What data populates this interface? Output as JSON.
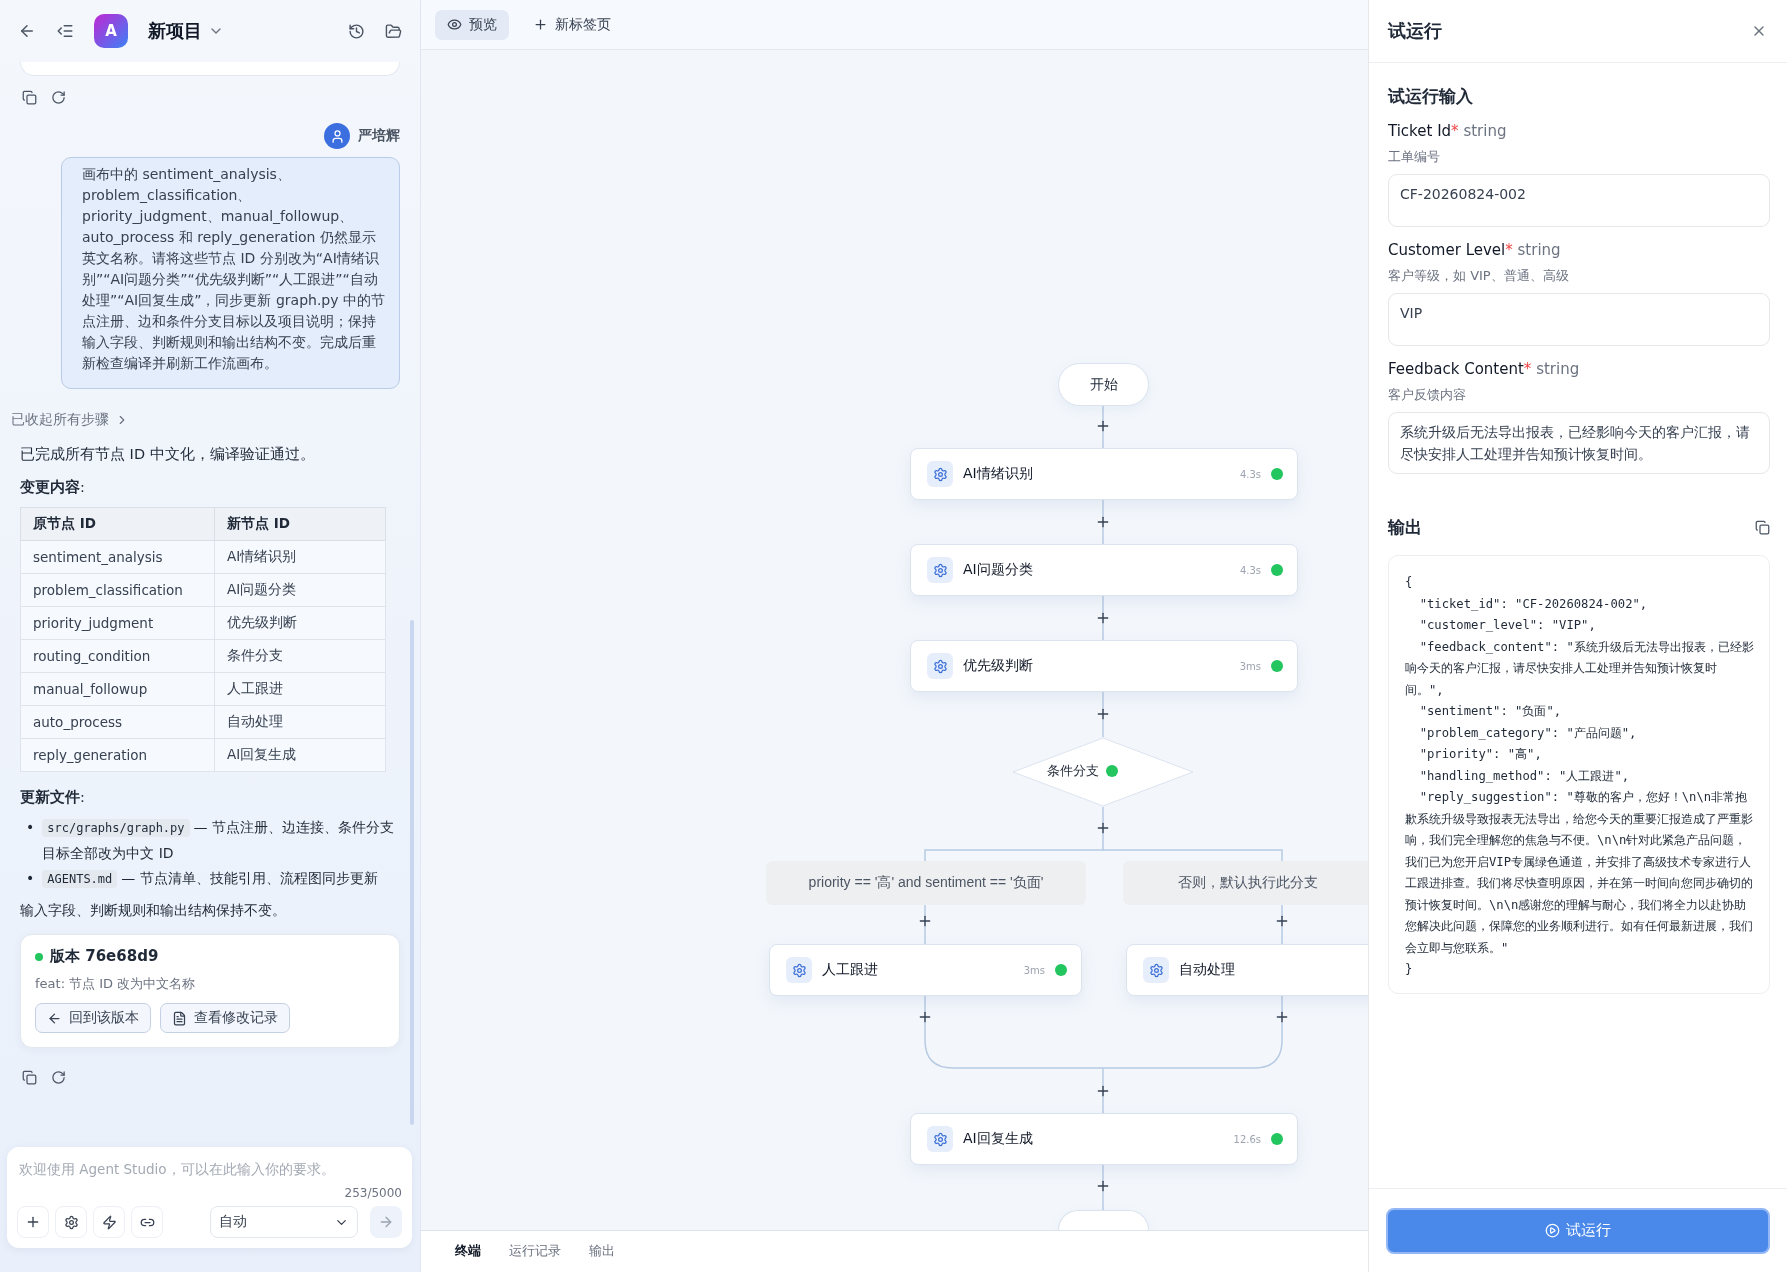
{
  "header": {
    "avatar": "A",
    "project": "新项目"
  },
  "user": {
    "name": "严培辉",
    "message": "画布中的 sentiment_analysis、problem_classification、priority_judgment、manual_followup、auto_process 和 reply_generation 仍然显示英文名称。请将这些节点 ID 分别改为“AI情绪识别”“AI问题分类”“优先级判断”“人工跟进”“自动处理”“AI回复生成”，同步更新 graph.py 中的节点注册、边和条件分支目标以及项目说明；保持输入字段、判断规则和输出结构不变。完成后重新检查编译并刷新工作流画布。"
  },
  "steps_link": "已收起所有步骤",
  "reply": {
    "summary": "已完成所有节点 ID 中文化，编译验证通过。",
    "changes_heading": "**变更内容**:",
    "table": {
      "columns": [
        "原节点 ID",
        "新节点 ID"
      ],
      "rows": [
        [
          "sentiment_analysis",
          "AI情绪识别"
        ],
        [
          "problem_classification",
          "AI问题分类"
        ],
        [
          "priority_judgment",
          "优先级判断"
        ],
        [
          "routing_condition",
          "条件分支"
        ],
        [
          "manual_followup",
          "人工跟进"
        ],
        [
          "auto_process",
          "自动处理"
        ],
        [
          "reply_generation",
          "AI回复生成"
        ]
      ]
    },
    "files_heading": "**更新文件**:",
    "files": [
      {
        "bullet": "•",
        "code": "src/graphs/graph.py",
        "text": "— 节点注册、边连接、条件分支目标全部改为中文 ID"
      },
      {
        "bullet": "•",
        "code": "AGENTS.md",
        "text": "— 节点清单、技能引用、流程图同步更新"
      }
    ],
    "note": "输入字段、判断规则和输出结构保持不变。"
  },
  "version": {
    "title": "版本 76e68d9",
    "color": "#22c55e",
    "message": "feat: 节点 ID 改为中文名称",
    "buttons": [
      "回到该版本",
      "查看修改记录"
    ]
  },
  "composer": {
    "placeholder": "欢迎使用 Agent Studio，可以在此输入你的要求。",
    "counter": "253/5000",
    "mode": "自动"
  },
  "canvas_tabs": [
    {
      "label": "预览",
      "selected": true
    },
    {
      "label": "新标签页",
      "selected": false
    }
  ],
  "flow": {
    "start": "开始",
    "nodes": [
      {
        "label": "AI情绪识别",
        "time": "4.3s",
        "color": "#22c55e"
      },
      {
        "label": "AI问题分类",
        "time": "4.3s",
        "color": "#22c55e"
      },
      {
        "label": "优先级判断",
        "time": "3ms",
        "color": "#22c55e"
      }
    ],
    "condition": {
      "label": "条件分支",
      "color": "#22c55e"
    },
    "branches": [
      {
        "condition": "priority == '高' and sentiment == '负面'",
        "node": {
          "label": "人工跟进",
          "time": "3ms",
          "color": "#22c55e"
        }
      },
      {
        "condition": "否则，默认执行此分支",
        "node": {
          "label": "自动处理"
        }
      }
    ],
    "final": {
      "label": "AI回复生成",
      "time": "12.6s",
      "color": "#22c55e"
    }
  },
  "bottom_tabs": [
    {
      "label": "终端",
      "selected": true
    },
    {
      "label": "运行记录",
      "selected": false
    },
    {
      "label": "输出",
      "selected": false
    }
  ],
  "panel": {
    "title": "试运行",
    "section": "试运行输入",
    "fields": [
      {
        "label": "Ticket Id",
        "required": "*",
        "type": "string",
        "hint": "工单编号",
        "value": "CF-20260824-002"
      },
      {
        "label": "Customer Level",
        "required": "*",
        "type": "string",
        "hint": "客户等级，如 VIP、普通、高级",
        "value": "VIP"
      },
      {
        "label": "Feedback Content",
        "required": "*",
        "type": "string",
        "hint": "客户反馈内容",
        "value": "系统升级后无法导出报表，已经影响今天的客户汇报，请尽快安排人工处理并告知预计恢复时间。"
      }
    ],
    "output_title": "输出",
    "output": [
      "{",
      "  \"ticket_id\": \"CF-20260824-002\",",
      "  \"customer_level\": \"VIP\",",
      "  \"feedback_content\": \"系统升级后无法导出报表，已经影响今天的客户汇报，请尽快安排人工处理并告知预计恢复时间。\",",
      "  \"sentiment\": \"负面\",",
      "  \"problem_category\": \"产品问题\",",
      "  \"priority\": \"高\",",
      "  \"handling_method\": \"人工跟进\",",
      "  \"reply_suggestion\": \"尊敬的客户，您好！\\n\\n非常抱歉系统升级导致报表无法导出，给您今天的重要汇报造成了严重影响，我们完全理解您的焦急与不便。\\n\\n针对此紧急产品问题，我们已为您开启VIP专属绿色通道，并安排了高级技术专家进行人工跟进排查。我们将尽快查明原因，并在第一时间向您同步确切的预计恢复时间。\\n\\n感谢您的理解与耐心，我们将全力以赴协助您解决此问题，保障您的业务顺利进行。如有任何最新进展，我们会立即与您联系。\"",
      "}"
    ],
    "run_button": "试运行"
  }
}
